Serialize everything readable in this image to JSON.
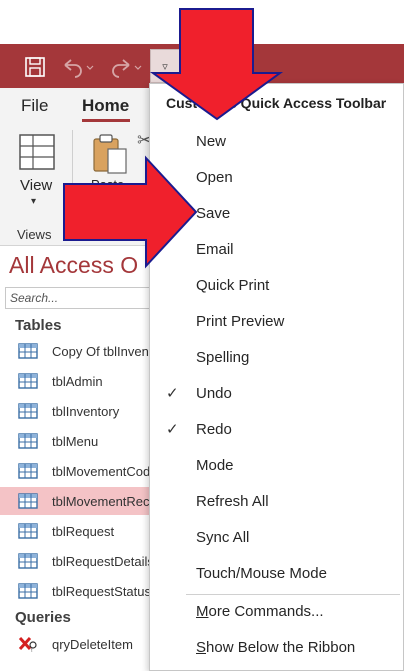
{
  "colors": {
    "brand": "#a4373a",
    "arrow_fill": "#f0202c",
    "arrow_stroke": "#1b1b8f",
    "selected_row": "#f4c3c6"
  },
  "qat": {
    "save_icon": "save-icon",
    "undo_icon": "undo-icon",
    "redo_icon": "redo-icon",
    "customize_glyph": "▿"
  },
  "ribbon": {
    "tabs": [
      {
        "label": "File"
      },
      {
        "label": "Home"
      }
    ],
    "views": {
      "button_label": "View",
      "group_label": "Views"
    },
    "paste_label": "Paste"
  },
  "nav_pane": {
    "title": "All Access O",
    "search_placeholder": "Search...",
    "sections": [
      {
        "header": "Tables",
        "items": [
          {
            "label": "Copy Of tblInven",
            "icon": "table-icon"
          },
          {
            "label": "tblAdmin",
            "icon": "table-icon"
          },
          {
            "label": "tblInventory",
            "icon": "table-icon"
          },
          {
            "label": "tblMenu",
            "icon": "table-icon"
          },
          {
            "label": "tblMovementCod",
            "icon": "table-icon"
          },
          {
            "label": "tblMovementRec",
            "icon": "table-icon",
            "selected": true
          },
          {
            "label": "tblRequest",
            "icon": "table-icon"
          },
          {
            "label": "tblRequestDetails",
            "icon": "table-icon"
          },
          {
            "label": "tblRequestStatus",
            "icon": "table-icon"
          }
        ]
      },
      {
        "header": "Queries",
        "items": [
          {
            "label": "qryDeleteItem",
            "icon": "delete-query-icon"
          }
        ]
      }
    ]
  },
  "menu": {
    "title": "Customize Quick Access Toolbar",
    "items": [
      {
        "label": "New",
        "checked": false
      },
      {
        "label": "Open",
        "checked": false
      },
      {
        "label": "Save",
        "checked": true
      },
      {
        "label": "Email",
        "checked": false
      },
      {
        "label": "Quick Print",
        "checked": false
      },
      {
        "label": "Print Preview",
        "checked": false
      },
      {
        "label": "Spelling",
        "checked": false
      },
      {
        "label": "Undo",
        "checked": true
      },
      {
        "label": "Redo",
        "checked": true
      },
      {
        "label": "Mode",
        "checked": false
      },
      {
        "label": "Refresh All",
        "checked": false
      },
      {
        "label": "Sync All",
        "checked": false
      },
      {
        "label": "Touch/Mouse Mode",
        "checked": false
      }
    ],
    "footer_items": [
      {
        "label": "More Commands...",
        "accel": "M"
      },
      {
        "label": "Show Below the Ribbon",
        "accel": "S"
      }
    ],
    "check_glyph": "✓"
  }
}
